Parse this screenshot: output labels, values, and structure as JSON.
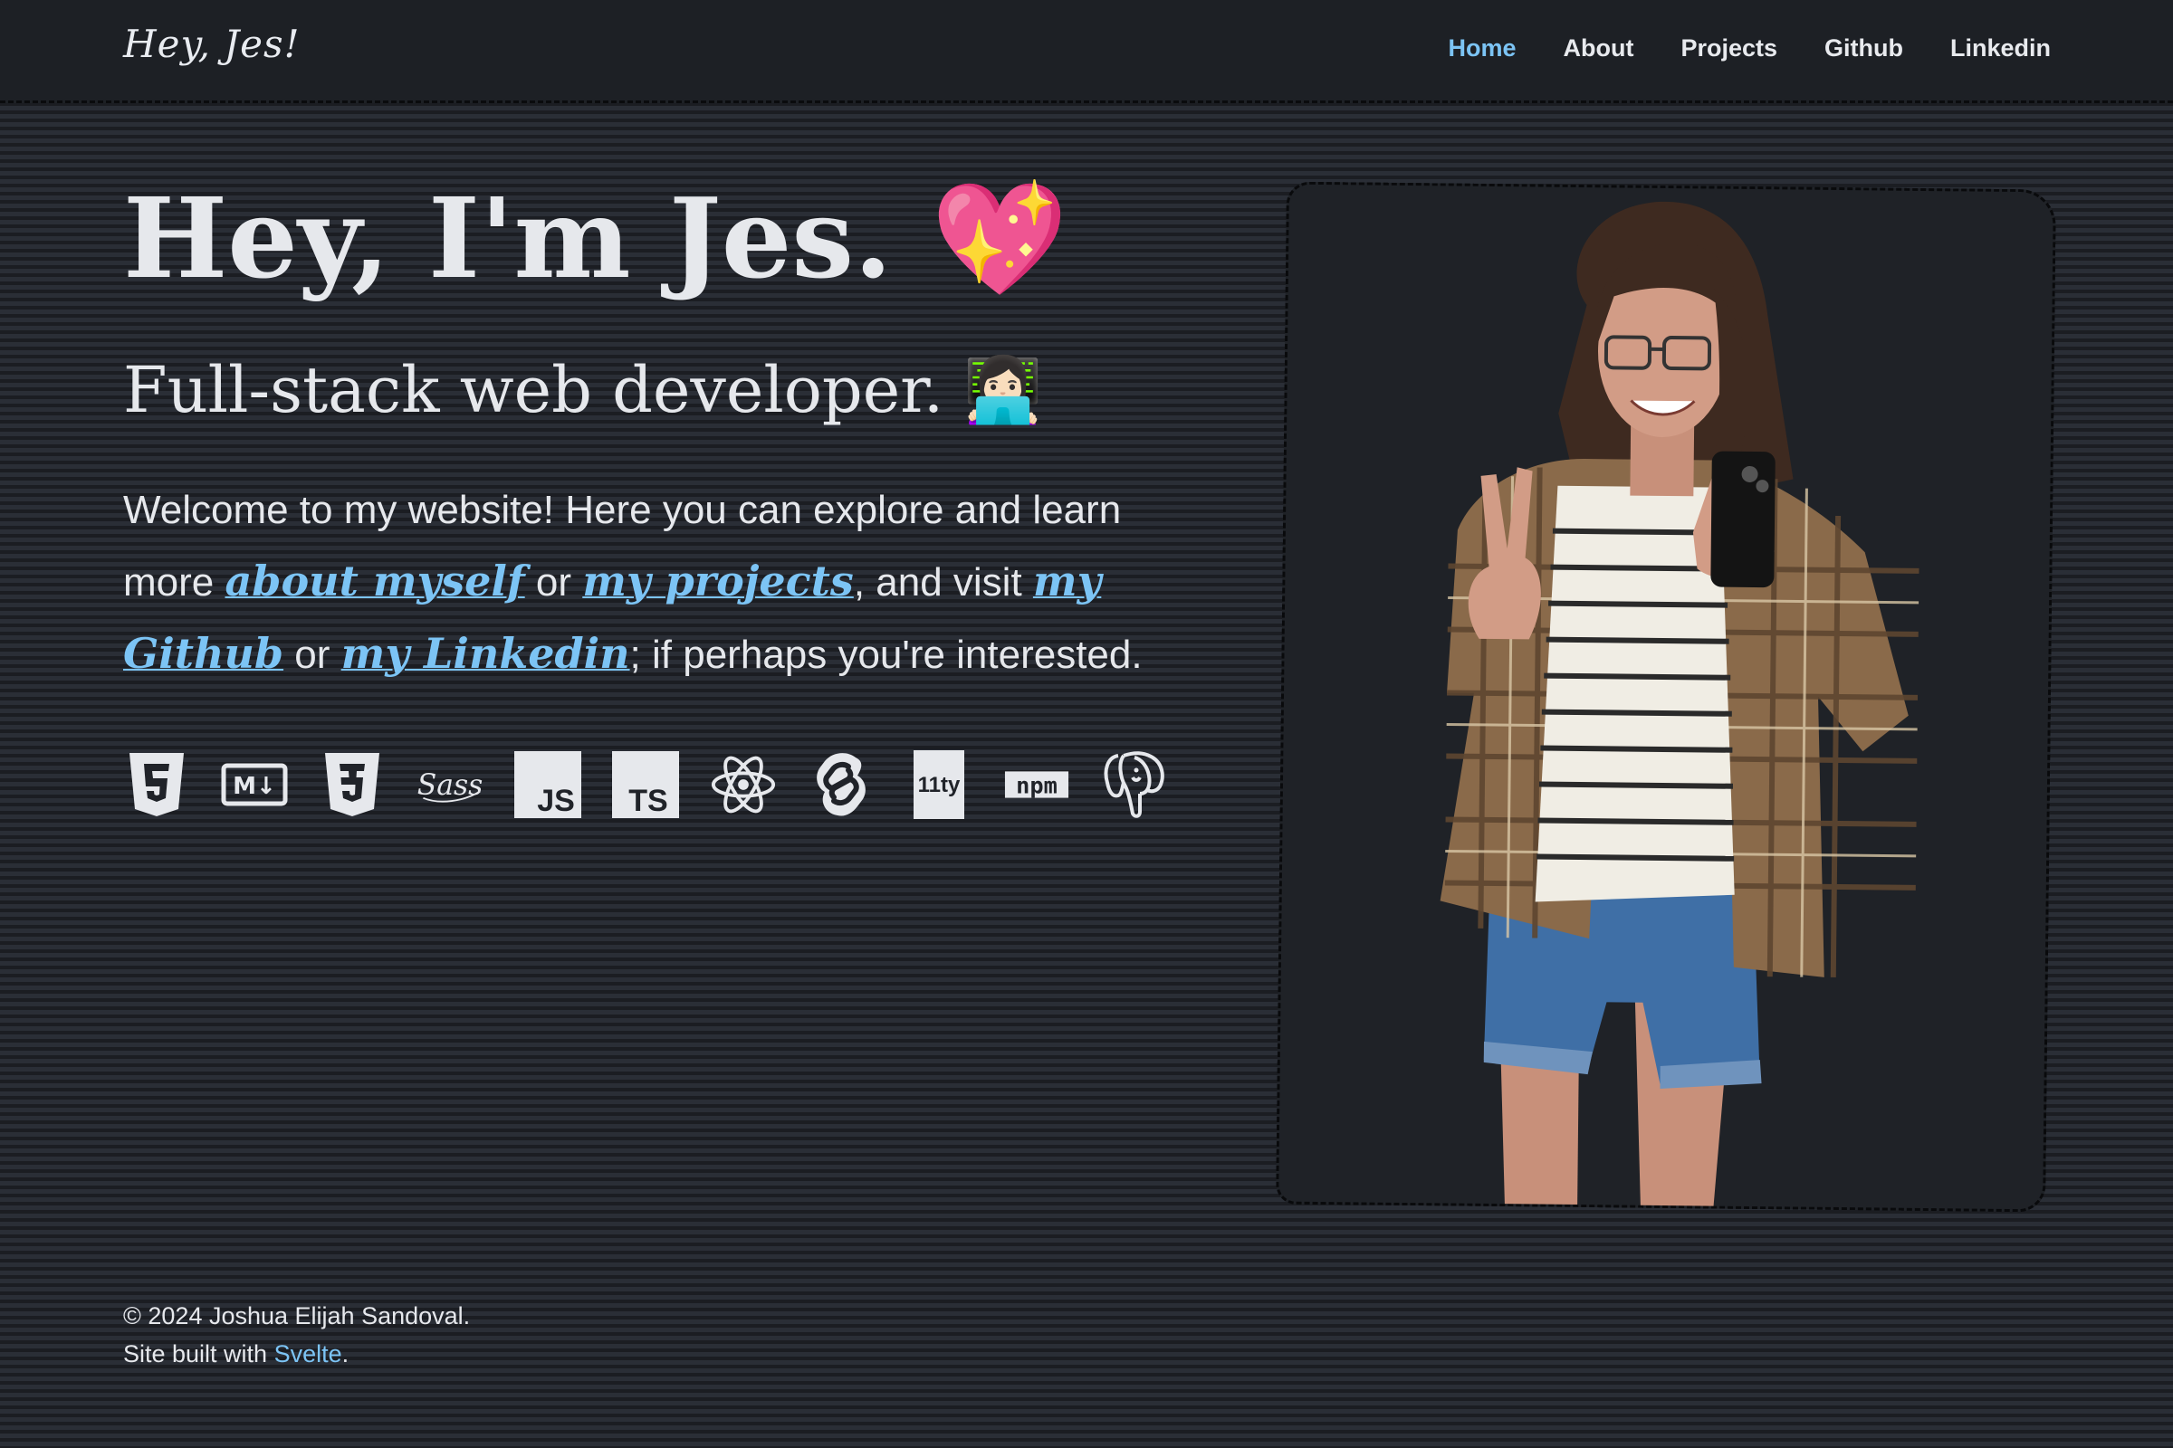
{
  "header": {
    "brand": "Hey, Jes!",
    "nav": [
      {
        "label": "Home",
        "active": true
      },
      {
        "label": "About",
        "active": false
      },
      {
        "label": "Projects",
        "active": false
      },
      {
        "label": "Github",
        "active": false
      },
      {
        "label": "Linkedin",
        "active": false
      }
    ]
  },
  "hero": {
    "title": "Hey, I'm Jes.",
    "title_emoji": "💖",
    "subtitle": "Full-stack web developer.",
    "subtitle_emoji": "👩🏻‍💻",
    "intro": {
      "p1": "Welcome to my website! Here you can explore and learn more ",
      "link_about": "about myself",
      "p2": " or ",
      "link_projects": "my projects",
      "p3": ", and visit ",
      "link_github": "my Github",
      "p4": " or ",
      "link_linkedin": "my Linkedin",
      "p5": "; if perhaps you're interested."
    }
  },
  "tech_icons": [
    "html5-icon",
    "markdown-icon",
    "css3-icon",
    "sass-icon",
    "javascript-icon",
    "typescript-icon",
    "react-icon",
    "svelte-icon",
    "eleventy-icon",
    "npm-icon",
    "postgresql-icon"
  ],
  "tech_labels": {
    "markdown": "M↓",
    "sass": "Sass",
    "js": "JS",
    "ts": "TS",
    "eleventy": "11ty",
    "npm": "npm"
  },
  "footer": {
    "copyright": "© 2024 Joshua Elijah Sandoval.",
    "built_prefix": "Site built with ",
    "built_link": "Svelte",
    "built_suffix": "."
  },
  "colors": {
    "accent": "#7cc4f5",
    "background": "#202329",
    "text": "#e6e8ec"
  }
}
